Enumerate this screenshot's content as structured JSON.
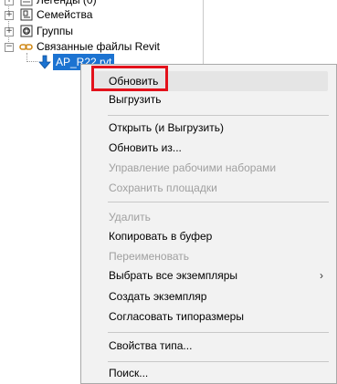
{
  "tree": {
    "items": [
      {
        "label": "Легенды (0)",
        "icon": "legend-icon",
        "expander": "+"
      },
      {
        "label": "Семейства",
        "icon": "families-icon",
        "expander": "+"
      },
      {
        "label": "Группы",
        "icon": "groups-icon",
        "expander": "+"
      },
      {
        "label": "Связанные файлы Revit",
        "icon": "link-icon",
        "expander": "−"
      },
      {
        "label": "AP_R22.rvt",
        "icon": "linked-file-arrow-icon",
        "selected": true
      }
    ]
  },
  "context_menu": {
    "items": [
      {
        "label": "Обновить",
        "enabled": true,
        "highlighted": true
      },
      {
        "label": "Выгрузить",
        "enabled": true
      },
      {
        "label": "Открыть (и Выгрузить)",
        "enabled": true
      },
      {
        "label": "Обновить из...",
        "enabled": true
      },
      {
        "label": "Управление рабочими наборами",
        "enabled": false
      },
      {
        "label": "Сохранить площадки",
        "enabled": false
      },
      {
        "label": "Удалить",
        "enabled": false
      },
      {
        "label": "Копировать в буфер",
        "enabled": true
      },
      {
        "label": "Переименовать",
        "enabled": false
      },
      {
        "label": "Выбрать все экземпляры",
        "enabled": true,
        "submenu_icon": "chevron-right-icon",
        "submenu_glyph": "›"
      },
      {
        "label": "Создать экземпляр",
        "enabled": true
      },
      {
        "label": "Согласовать типоразмеры",
        "enabled": true
      },
      {
        "label": "Свойства типа...",
        "enabled": true
      },
      {
        "label": "Поиск...",
        "enabled": true
      }
    ]
  },
  "colors": {
    "selection_blue": "#1c73d1",
    "highlight_red": "#e3121b",
    "menu_background": "#f2f2f2",
    "disabled_text": "#a0a0a0"
  }
}
